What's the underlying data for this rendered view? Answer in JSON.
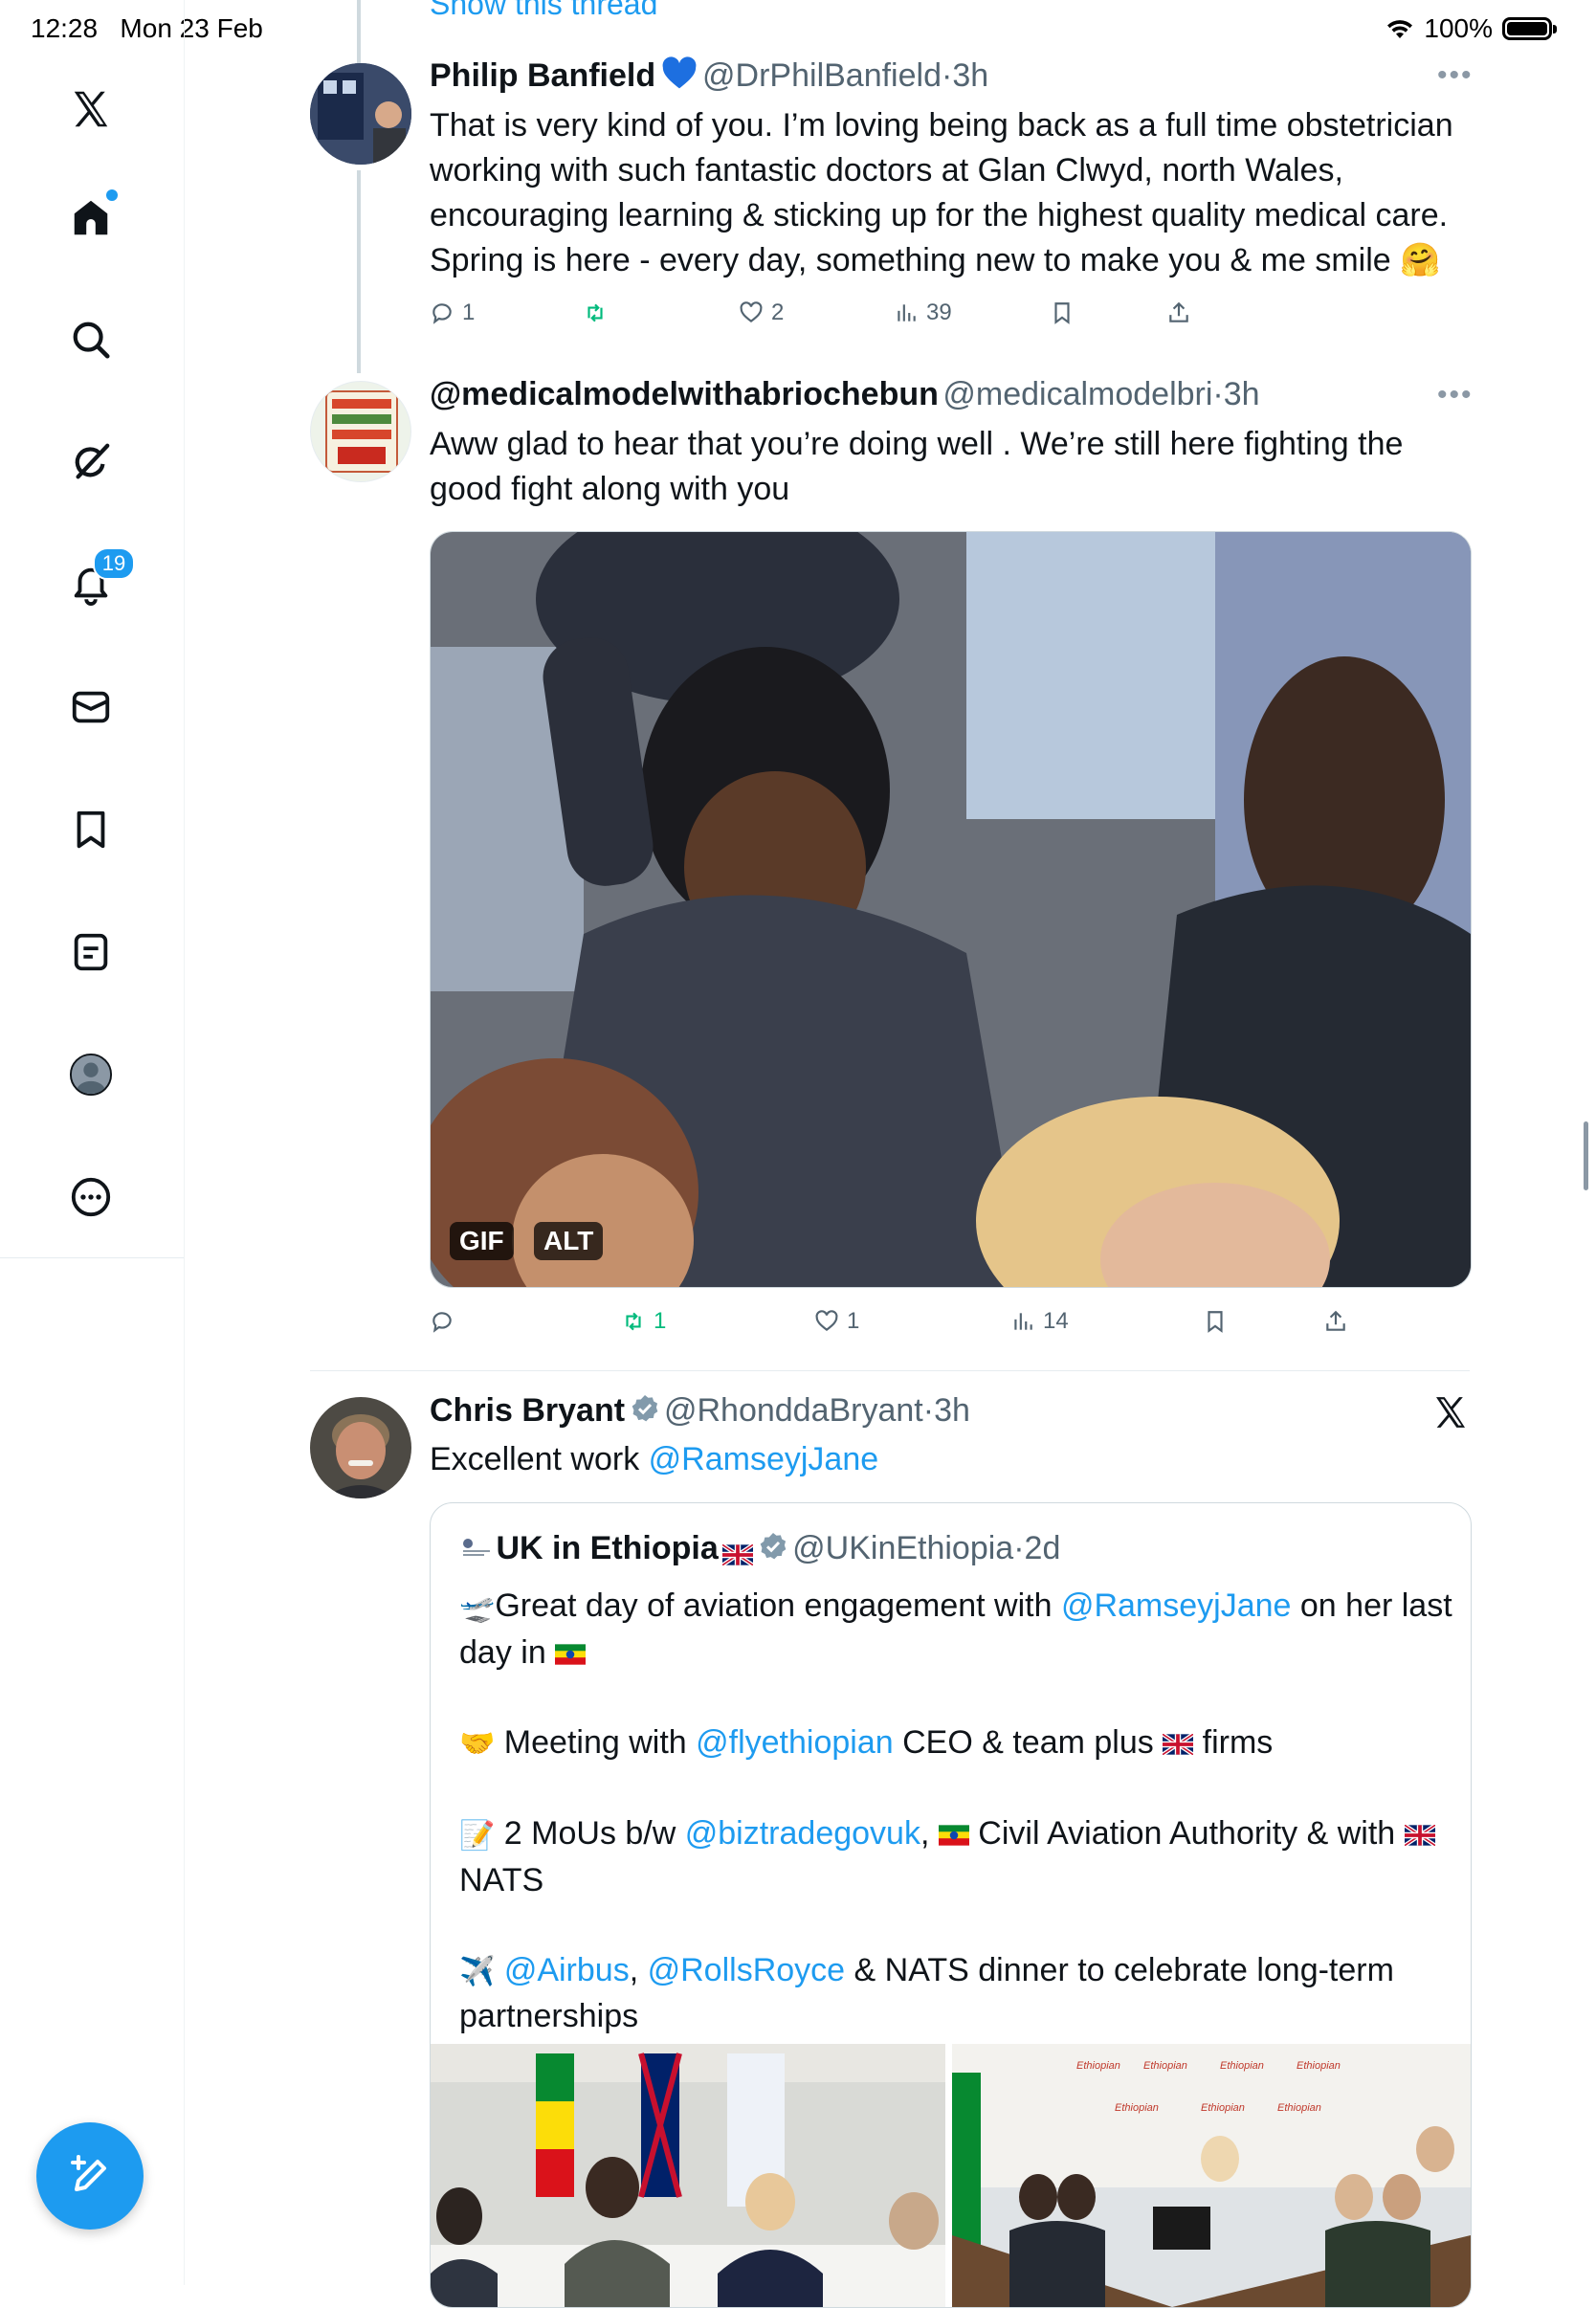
{
  "status_bar": {
    "time": "12:28",
    "date": "Mon 23 Feb",
    "battery": "100%"
  },
  "sidebar": {
    "notifications_badge": "19",
    "items": [
      {
        "icon": "x-logo-icon"
      },
      {
        "icon": "home-icon"
      },
      {
        "icon": "search-icon"
      },
      {
        "icon": "grok-icon"
      },
      {
        "icon": "bell-icon"
      },
      {
        "icon": "mail-icon"
      },
      {
        "icon": "bookmark-icon"
      },
      {
        "icon": "lists-icon"
      },
      {
        "icon": "profile-icon"
      },
      {
        "icon": "more-icon"
      }
    ]
  },
  "thread": {
    "show_thread": "Show this thread"
  },
  "tweet1": {
    "name": "Philip Banfield",
    "handle": "@DrPhilBanfield",
    "time": "3h",
    "text": "That is very kind of you. I’m loving being back as a full time obstetrician working with such fantastic doctors at Glan Clwyd, north Wales, encouraging learning & sticking up for the highest quality medical care. Spring is here - every day, something new to make you & me smile 🤗",
    "replies": "1",
    "likes": "2",
    "views": "39"
  },
  "tweet2": {
    "name": "@medicalmodelwithabriochebun",
    "handle": "@medicalmodelbri",
    "time": "3h",
    "text": "Aww glad to hear that you’re doing well . We’re still here fighting the good fight along with you",
    "gif_label": "GIF",
    "alt_label": "ALT",
    "retweets": "1",
    "likes": "1",
    "views": "14"
  },
  "tweet3": {
    "name": "Chris Bryant",
    "handle": "@RhonddaBryant",
    "time": "3h",
    "text_prefix": "Excellent work ",
    "mention": "@RamseyjJane"
  },
  "quote": {
    "name": "UK in Ethiopia",
    "handle": "@UKinEthiopia",
    "time": "2d",
    "line1_a": "Great day of aviation engagement with ",
    "line1_mention": "@RamseyjJane",
    "line1_b": " on her last day in ",
    "line2_a": " Meeting with ",
    "line2_mention": "@flyethiopian",
    "line2_b": " CEO & team plus ",
    "line2_c": " firms",
    "line3_a": " 2 MoUs b/w ",
    "line3_mention": "@biztradegovuk",
    "line3_b": ", ",
    "line3_c": " Civil Aviation Authority & with ",
    "line3_d": " NATS",
    "line4_mention1": "@Airbus",
    "line4_sep": ", ",
    "line4_mention2": "@RollsRoyce",
    "line4_b": " & NATS dinner to celebrate long-term partnerships",
    "banner_text": "Ethiopian"
  },
  "colors": {
    "accent": "#1d9bf0",
    "text": "#0f1419",
    "muted": "#536471",
    "retweet_green": "#00ba7c"
  }
}
